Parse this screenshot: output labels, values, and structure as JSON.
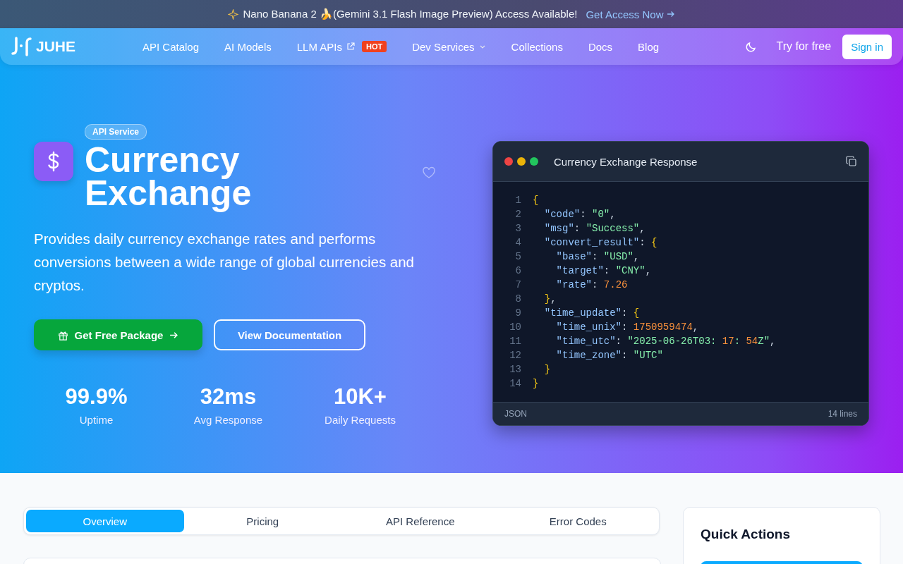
{
  "announcement": {
    "text": "Nano Banana 2 🍌(Gemini 3.1 Flash Image Preview) Access Available!",
    "link": "Get Access Now"
  },
  "nav": {
    "logo": "JUHE",
    "items": [
      {
        "label": "API Catalog",
        "kind": "plain"
      },
      {
        "label": "AI Models",
        "kind": "plain"
      },
      {
        "label": "LLM APIs",
        "kind": "external",
        "badge": "HOT"
      },
      {
        "label": "Dev Services",
        "kind": "dropdown"
      },
      {
        "label": "Collections",
        "kind": "plain"
      },
      {
        "label": "Docs",
        "kind": "plain"
      },
      {
        "label": "Blog",
        "kind": "plain"
      }
    ],
    "try": "Try for free",
    "signin": "Sign in"
  },
  "hero": {
    "tag": "API Service",
    "title": "Currency Exchange",
    "description": "Provides daily currency exchange rates and performs conversions between a wide range of global currencies and cryptos.",
    "primary": "Get Free Package",
    "secondary": "View Documentation",
    "stats": [
      {
        "value": "99.9%",
        "label": "Uptime"
      },
      {
        "value": "32ms",
        "label": "Avg Response"
      },
      {
        "value": "10K+",
        "label": "Daily Requests"
      }
    ]
  },
  "code": {
    "title": "Currency Exchange Response",
    "language": "JSON",
    "count": "14 lines",
    "lines": [
      {
        "n": "1",
        "tokens": [
          {
            "t": "{",
            "kind": "brace"
          }
        ]
      },
      {
        "n": "2",
        "tokens": [
          {
            "t": "\"code\"",
            "kind": "key"
          },
          {
            "t": ": ",
            "kind": "punct"
          },
          {
            "t": "\"0\"",
            "kind": "str"
          },
          {
            "t": ",",
            "kind": "punct"
          }
        ]
      },
      {
        "n": "3",
        "tokens": [
          {
            "t": "\"msg\"",
            "kind": "key"
          },
          {
            "t": ": ",
            "kind": "punct"
          },
          {
            "t": "\"Success\"",
            "kind": "str"
          },
          {
            "t": ",",
            "kind": "punct"
          }
        ]
      },
      {
        "n": "4",
        "tokens": [
          {
            "t": "\"convert_result\"",
            "kind": "key"
          },
          {
            "t": ": ",
            "kind": "punct"
          },
          {
            "t": "{",
            "kind": "brace"
          }
        ]
      },
      {
        "n": "5",
        "tokens": [
          {
            "t": "\"base\"",
            "kind": "key"
          },
          {
            "t": ": ",
            "kind": "punct"
          },
          {
            "t": "\"USD\"",
            "kind": "str"
          },
          {
            "t": ",",
            "kind": "punct"
          }
        ]
      },
      {
        "n": "6",
        "tokens": [
          {
            "t": "\"target\"",
            "kind": "key"
          },
          {
            "t": ": ",
            "kind": "punct"
          },
          {
            "t": "\"CNY\"",
            "kind": "str"
          },
          {
            "t": ",",
            "kind": "punct"
          }
        ]
      },
      {
        "n": "7",
        "tokens": [
          {
            "t": "\"rate\"",
            "kind": "key"
          },
          {
            "t": ": ",
            "kind": "punct"
          },
          {
            "t": "7.26",
            "kind": "num"
          }
        ]
      },
      {
        "n": "8",
        "tokens": [
          {
            "t": "}",
            "kind": "brace"
          },
          {
            "t": ",",
            "kind": "punct"
          }
        ]
      },
      {
        "n": "9",
        "tokens": [
          {
            "t": "\"time_update\"",
            "kind": "key"
          },
          {
            "t": ": ",
            "kind": "punct"
          },
          {
            "t": "{",
            "kind": "brace"
          }
        ]
      },
      {
        "n": "10",
        "tokens": [
          {
            "t": "\"time_unix\"",
            "kind": "key"
          },
          {
            "t": ": ",
            "kind": "punct"
          },
          {
            "t": "1750959474",
            "kind": "num"
          },
          {
            "t": ",",
            "kind": "punct"
          }
        ]
      },
      {
        "n": "11",
        "tokens": [
          {
            "t": "\"time_utc\"",
            "kind": "key"
          },
          {
            "t": ": ",
            "kind": "punct"
          },
          {
            "t": "\"2025-06-26T03: ",
            "kind": "str"
          },
          {
            "t": "17",
            "kind": "num"
          },
          {
            "t": ": ",
            "kind": "str"
          },
          {
            "t": "54",
            "kind": "num"
          },
          {
            "t": "Z\"",
            "kind": "str"
          },
          {
            "t": ",",
            "kind": "punct"
          }
        ]
      },
      {
        "n": "12",
        "tokens": [
          {
            "t": "\"time_zone\"",
            "kind": "key"
          },
          {
            "t": ": ",
            "kind": "punct"
          },
          {
            "t": "\"UTC\"",
            "kind": "str"
          }
        ]
      },
      {
        "n": "13",
        "tokens": [
          {
            "t": "}",
            "kind": "brace"
          }
        ]
      },
      {
        "n": "14",
        "tokens": [
          {
            "t": "}",
            "kind": "brace"
          }
        ]
      }
    ]
  },
  "tabs": [
    {
      "label": "Overview",
      "selected": true
    },
    {
      "label": "Pricing",
      "selected": false
    },
    {
      "label": "API Reference",
      "selected": false
    },
    {
      "label": "Error Codes",
      "selected": false
    }
  ],
  "quick_actions": {
    "title": "Quick Actions"
  }
}
